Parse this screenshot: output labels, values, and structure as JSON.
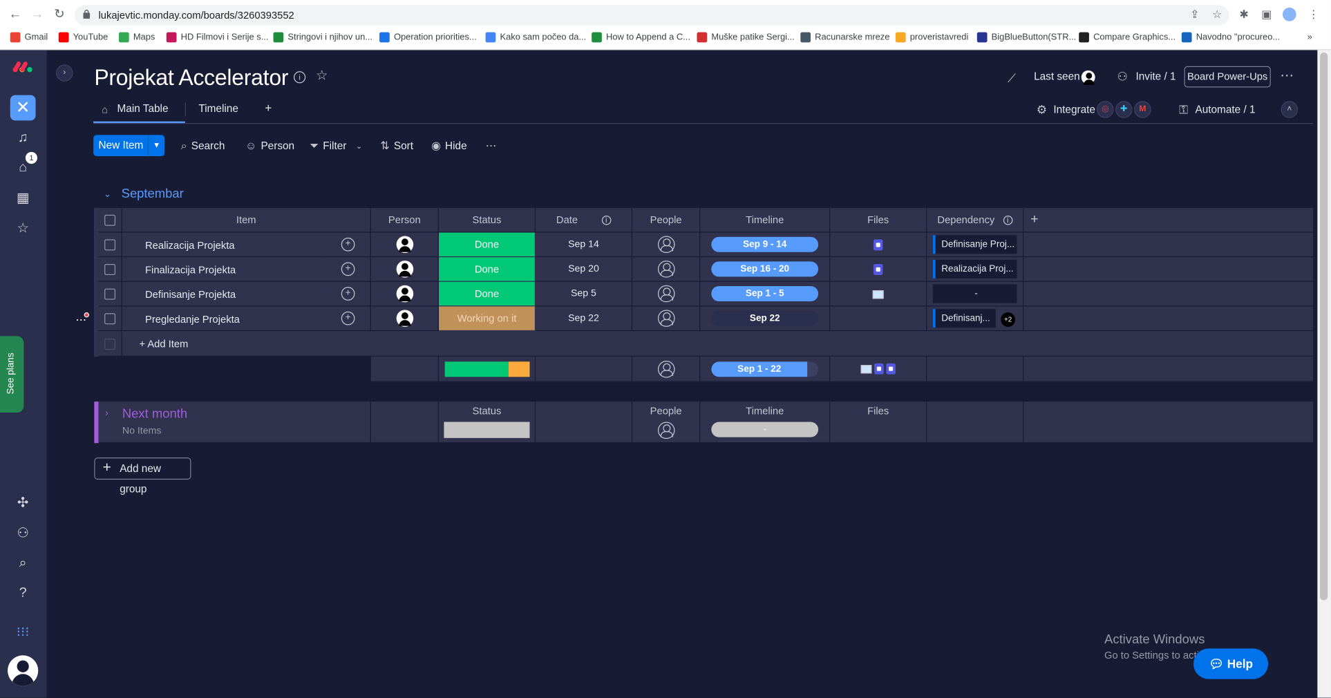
{
  "browser": {
    "url": "lukajevtic.monday.com/boards/3260393552",
    "bookmarks": [
      {
        "label": "Gmail",
        "color": "#ea4335"
      },
      {
        "label": "YouTube",
        "color": "#ff0000"
      },
      {
        "label": "Maps",
        "color": "#34a853"
      },
      {
        "label": "HD Filmovi i Serije s...",
        "color": "#c2185b"
      },
      {
        "label": "Stringovi i njihov un...",
        "color": "#1e8e3e"
      },
      {
        "label": "Operation priorities...",
        "color": "#1a73e8"
      },
      {
        "label": "Kako sam počeo da...",
        "color": "#4285f4"
      },
      {
        "label": "How to Append a C...",
        "color": "#1e8e3e"
      },
      {
        "label": "Muške patike Sergi...",
        "color": "#d32f2f"
      },
      {
        "label": "Racunarske mreze",
        "color": "#455a64"
      },
      {
        "label": "proveristavredi",
        "color": "#f9a825"
      },
      {
        "label": "BigBlueButton(STR...",
        "color": "#283593"
      },
      {
        "label": "Compare Graphics...",
        "color": "#212121"
      },
      {
        "label": "Navodno \"procureo...",
        "color": "#1565c0"
      }
    ]
  },
  "board": {
    "title": "Projekat Accelerator",
    "last_seen": "Last seen",
    "invite": "Invite / 1",
    "power_ups": "Board Power-Ups",
    "integrate": "Integrate",
    "automate": "Automate / 1",
    "tabs": [
      "Main Table",
      "Timeline",
      "+"
    ]
  },
  "toolbar": {
    "new_item": "New Item",
    "search": "Search",
    "person": "Person",
    "filter": "Filter",
    "sort": "Sort",
    "hide": "Hide"
  },
  "sidebar": {
    "see_plans": "See plans",
    "inbox_badge": "1"
  },
  "group1": {
    "title": "Septembar",
    "color": "#579bfc",
    "columns": [
      "Item",
      "Person",
      "Status",
      "Date",
      "People",
      "Timeline",
      "Files",
      "Dependency"
    ],
    "rows": [
      {
        "item": "Realizacija Projekta",
        "status": "Done",
        "status_color": "#00c875",
        "date": "Sep 14",
        "timeline": "Sep 9 - 14",
        "dependency": "Definisanje Proj..."
      },
      {
        "item": "Finalizacija Projekta",
        "status": "Done",
        "status_color": "#00c875",
        "date": "Sep 20",
        "timeline": "Sep 16 - 20",
        "dependency": "Realizacija Proj..."
      },
      {
        "item": "Definisanje Projekta",
        "status": "Done",
        "status_color": "#00c875",
        "date": "Sep 5",
        "timeline": "Sep 1 - 5",
        "dependency": "-"
      },
      {
        "item": "Pregledanje Projekta",
        "status": "Working on it",
        "status_color": "#fdab3d",
        "date": "Sep 22",
        "timeline": "Sep 22",
        "dependency": "Definisanj...",
        "dependency_more": "+2"
      }
    ],
    "add_item": "+ Add Item",
    "summary": {
      "timeline": "Sep 1 - 22",
      "status_done_fraction": 0.75,
      "status_working_fraction": 0.25
    }
  },
  "group2": {
    "title": "Next month",
    "color": "#a25ddc",
    "columns": [
      "Status",
      "People",
      "Timeline",
      "Files"
    ],
    "no_items": "No Items",
    "timeline_empty": "-"
  },
  "add_new_group": "Add new group",
  "activate": {
    "line1": "Activate Windows",
    "line2": "Go to Settings to activate Windows."
  },
  "help": "Help"
}
